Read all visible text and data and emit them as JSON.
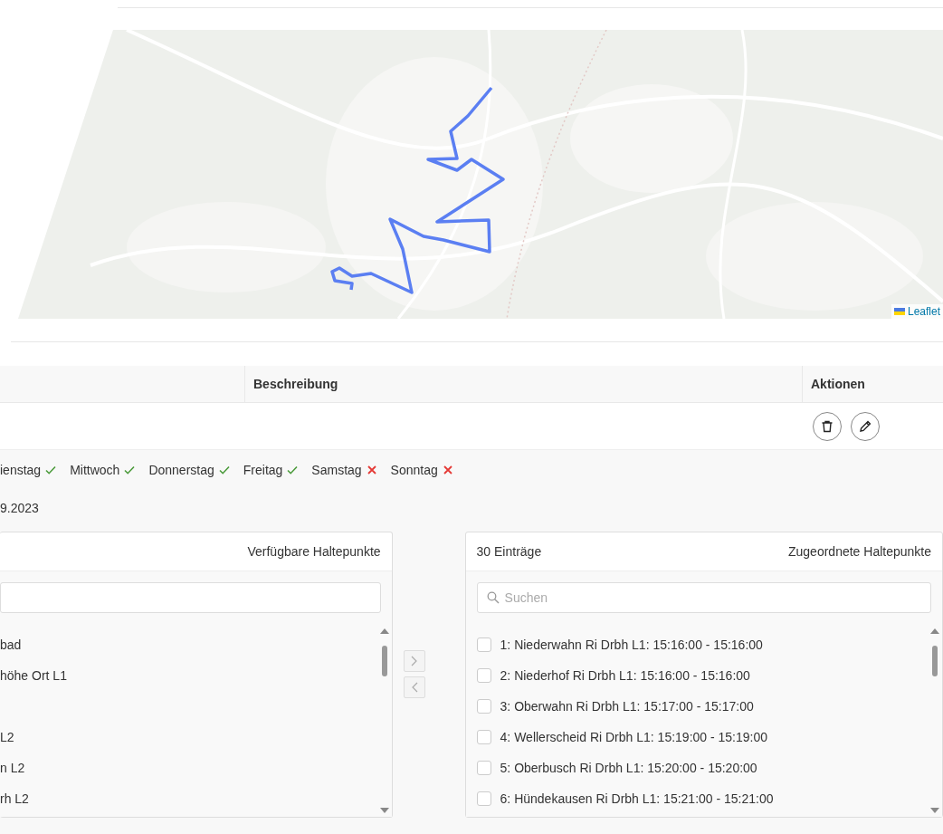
{
  "map": {
    "kind": "picture",
    "attribution": "Leaflet"
  },
  "table": {
    "columns": [
      "Beschreibung",
      "Aktionen"
    ]
  },
  "detail": {
    "days": [
      {
        "name": "ienstag",
        "on": true
      },
      {
        "name": "Mittwoch",
        "on": true
      },
      {
        "name": "Donnerstag",
        "on": true
      },
      {
        "name": "Freitag",
        "on": true
      },
      {
        "name": "Samstag",
        "on": false
      },
      {
        "name": "Sonntag",
        "on": false
      }
    ],
    "date": "9.2023"
  },
  "available": {
    "title": "Verfügbare Haltepunkte",
    "items": [
      {
        "kind": "stop",
        "text": "bad"
      },
      {
        "kind": "stop",
        "text": "höhe Ort L1"
      },
      {
        "kind": "blank"
      },
      {
        "kind": "stop",
        "text": "L2"
      },
      {
        "kind": "stop",
        "text": "n L2"
      },
      {
        "kind": "stop",
        "text": "rh L2"
      }
    ]
  },
  "assigned": {
    "count": "30 Einträge",
    "title": "Zugeordnete Haltepunkte",
    "search": {
      "placeholder": "Suchen"
    },
    "items": [
      {
        "text": "1: Niederwahn Ri Drbh L1: 15:16:00 - 15:16:00",
        "checked": false
      },
      {
        "text": "2: Niederhof Ri Drbh L1: 15:16:00 - 15:16:00",
        "checked": false
      },
      {
        "text": "3: Oberwahn Ri Drbh L1: 15:17:00 - 15:17:00",
        "checked": false
      },
      {
        "text": "4: Wellerscheid Ri Drbh L1: 15:19:00 - 15:19:00",
        "checked": false
      },
      {
        "text": "5: Oberbusch Ri Drbh L1: 15:20:00 - 15:20:00",
        "checked": false
      },
      {
        "text": "6: Hündekausen Ri Drbh L1: 15:21:00 - 15:21:00",
        "checked": false
      }
    ]
  }
}
